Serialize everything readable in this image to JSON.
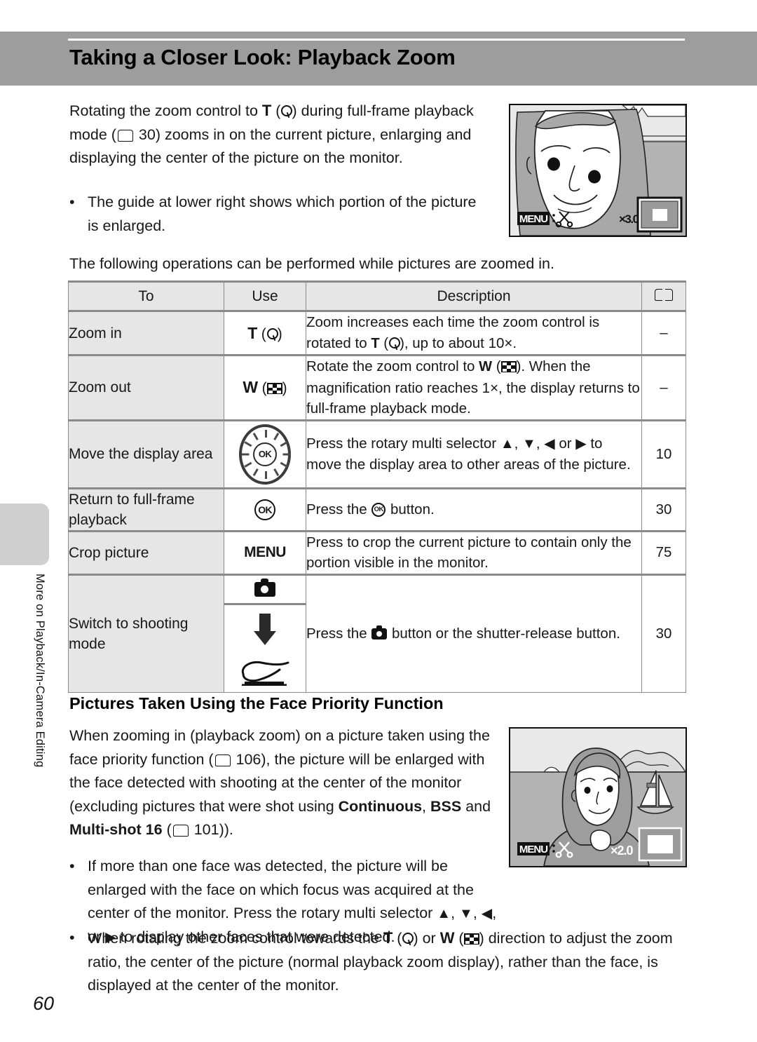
{
  "header": {
    "title": "Taking a Closer Look: Playback Zoom"
  },
  "sidebar": {
    "label": "More on Playback/In-Camera Editing"
  },
  "intro": {
    "p1_a": "Rotating the zoom control to ",
    "p1_T": "T",
    "p1_b": ") during full-frame playback mode (",
    "p1_page": "30",
    "p1_c": ") zooms in on the current picture, enlarging and displaying the center of the picture on the monitor.",
    "bullet1": "The guide at lower right shows which portion of the picture is enlarged.",
    "lead_in": "The following operations can be performed while pictures are zoomed in."
  },
  "top_screenshot": {
    "menu_label": "MENU",
    "scissors_icon": "scissors-icon",
    "magnification": "×3.0"
  },
  "table": {
    "headers": {
      "to": "To",
      "use": "Use",
      "description": "Description",
      "page": "book-icon"
    },
    "rows": [
      {
        "to": "Zoom in",
        "use_icon": "zoom-tele-icon",
        "use_letter": "T",
        "desc_a": "Zoom increases each time the zoom control is rotated to ",
        "desc_T": "T",
        "desc_b": "), up to about 10×.",
        "page": "–"
      },
      {
        "to": "Zoom out",
        "use_icon": "zoom-wide-icon",
        "use_letter": "W",
        "desc_a": "Rotate the zoom control to ",
        "desc_W": "W",
        "desc_b": "). When the magnification ratio reaches 1×, the display returns to full-frame playback mode.",
        "page": "–"
      },
      {
        "to": "Move the display area",
        "use_icon": "rotary-multi-selector-icon",
        "use_letter": "OK",
        "desc_a": "Press the rotary multi selector ",
        "desc_b": " to move the display area to other areas of the picture.",
        "page": "10"
      },
      {
        "to": "Return to full-frame playback",
        "use_icon": "ok-button-icon",
        "use_letter": "OK",
        "desc_a": "Press the ",
        "desc_b": " button.",
        "page": "30"
      },
      {
        "to": "Crop picture",
        "use_icon": "menu-button-icon",
        "use_letter": "MENU",
        "desc_a": "Press to crop the current picture to contain only the portion visible in the monitor.",
        "page": "75"
      },
      {
        "to": "Switch to shooting mode",
        "use_icon": "shooting-mode-button-icon",
        "use_letter": "",
        "desc_a": "Press the ",
        "desc_b": " button or the shutter-release button.",
        "page": "30"
      }
    ]
  },
  "face_priority": {
    "heading": "Pictures Taken Using the Face Priority Function",
    "para_a": "When zooming in (playback zoom) on a picture taken using the face priority function (",
    "para_page1": "106",
    "para_b": "), the picture will be enlarged with the face detected with shooting at the center of the monitor (excluding pictures that were shot using ",
    "bold1": "Continuous",
    "para_c": ", ",
    "bold2": "BSS",
    "para_d": " and ",
    "bold3": "Multi-shot 16",
    "para_e": " (",
    "para_page2": "101",
    "para_f": ")).",
    "bullet1_a": "If more than one face was detected, the picture will be enlarged with the face on which focus was acquired at the center of the monitor. Press the rotary multi selector ",
    "bullet1_b": " to display other faces that were detected.",
    "bullet2_a": "When rotating the zoom control towards the ",
    "bullet2_T": "T",
    "bullet2_mid": ") or ",
    "bullet2_W": "W",
    "bullet2_b": ") direction to adjust the zoom ratio, the center of the picture (normal playback zoom display), rather than the face, is displayed at the center of the monitor.",
    "screenshot": {
      "menu_label": "MENU",
      "scissors_icon": "scissors-icon",
      "magnification": "×2.0"
    }
  },
  "page_number": "60",
  "colors": {
    "header_band": "#9d9d9d",
    "table_header_bg": "#e6e6e6",
    "side_tab": "#cfcfcf",
    "rule": "#8a8a8a"
  }
}
